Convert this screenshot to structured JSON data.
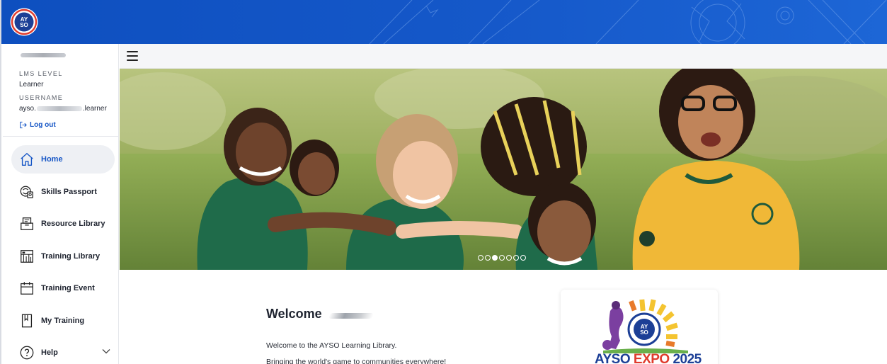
{
  "brand": {
    "logo_text": "AYSO",
    "colors": {
      "primary": "#1558c9",
      "accent_red": "#e03b2d",
      "accent_yellow": "#f4c430"
    }
  },
  "profile": {
    "lms_level_label": "LMS LEVEL",
    "lms_level_value": "Learner",
    "username_label": "USERNAME",
    "username_prefix": "ayso.",
    "username_suffix": ".learner",
    "logout_label": "Log out"
  },
  "nav": {
    "items": [
      {
        "label": "Home",
        "icon": "home-icon",
        "active": true
      },
      {
        "label": "Skills Passport",
        "icon": "skills-passport-icon",
        "active": false
      },
      {
        "label": "Resource Library",
        "icon": "resource-library-icon",
        "active": false
      },
      {
        "label": "Training Library",
        "icon": "training-library-icon",
        "active": false
      },
      {
        "label": "Training Event",
        "icon": "calendar-icon",
        "active": false
      },
      {
        "label": "My Training",
        "icon": "my-training-icon",
        "active": false
      },
      {
        "label": "Help",
        "icon": "help-icon",
        "active": false
      }
    ]
  },
  "hero": {
    "slide_count": 7,
    "active_slide": 3
  },
  "main": {
    "welcome_title": "Welcome",
    "intro_line_1": "Welcome to the AYSO Learning Library.",
    "intro_line_2": "Bringing the world's game to communities everywhere!"
  },
  "expo": {
    "word_a": "AYSO",
    "word_b": "EXPO",
    "word_c": "2025"
  }
}
